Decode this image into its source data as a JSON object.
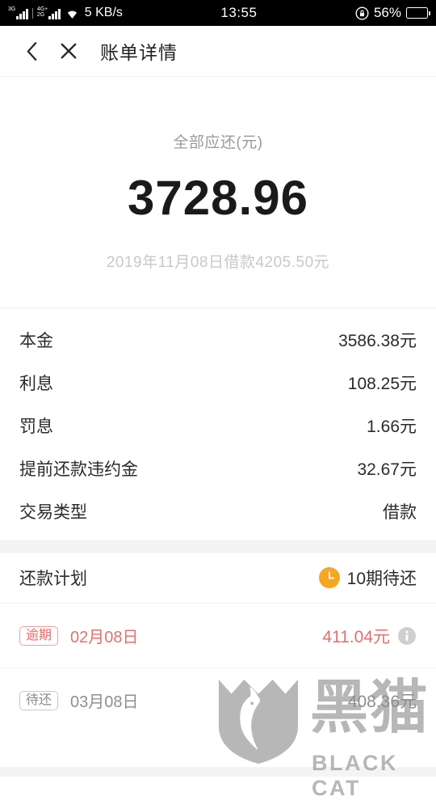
{
  "status_bar": {
    "network_label_1": "3G",
    "network_label_2": "4G+",
    "network_label_3": "2G",
    "speed": "5 KB/s",
    "time": "13:55",
    "battery_percent": "56%",
    "battery_level": 56,
    "lock_icon": "lock-icon",
    "wifi_icon": "wifi-icon",
    "battery_icon": "battery-icon"
  },
  "header": {
    "back_icon": "chevron-left-icon",
    "close_icon": "close-icon",
    "title": "账单详情"
  },
  "summary": {
    "label": "全部应还(元)",
    "amount": "3728.96",
    "sub": "2019年11月08日借款4205.50元"
  },
  "details": {
    "rows": [
      {
        "label": "本金",
        "value": "3586.38元"
      },
      {
        "label": "利息",
        "value": "108.25元"
      },
      {
        "label": "罚息",
        "value": "1.66元"
      },
      {
        "label": "提前还款违约金",
        "value": "32.67元"
      },
      {
        "label": "交易类型",
        "value": "借款"
      }
    ]
  },
  "plan": {
    "title": "还款计划",
    "status_icon": "clock-icon",
    "status_text": "10期待还",
    "rows": [
      {
        "badge": "逾期",
        "date": "02月08日",
        "amount": "411.04元",
        "info_icon": "info-icon",
        "state": "overdue"
      },
      {
        "badge": "待还",
        "date": "03月08日",
        "amount": "408.36元",
        "state": "pending"
      }
    ]
  },
  "watermark": {
    "cn": "黑猫",
    "en": "BLACK CAT",
    "logo_icon": "cat-shield-logo-icon"
  },
  "colors": {
    "overdue": "#e07070",
    "pending": "#8f8f8f",
    "accent_clock": "#f5a623",
    "text_primary": "#2b2b2b",
    "text_muted": "#9a9a9a"
  }
}
